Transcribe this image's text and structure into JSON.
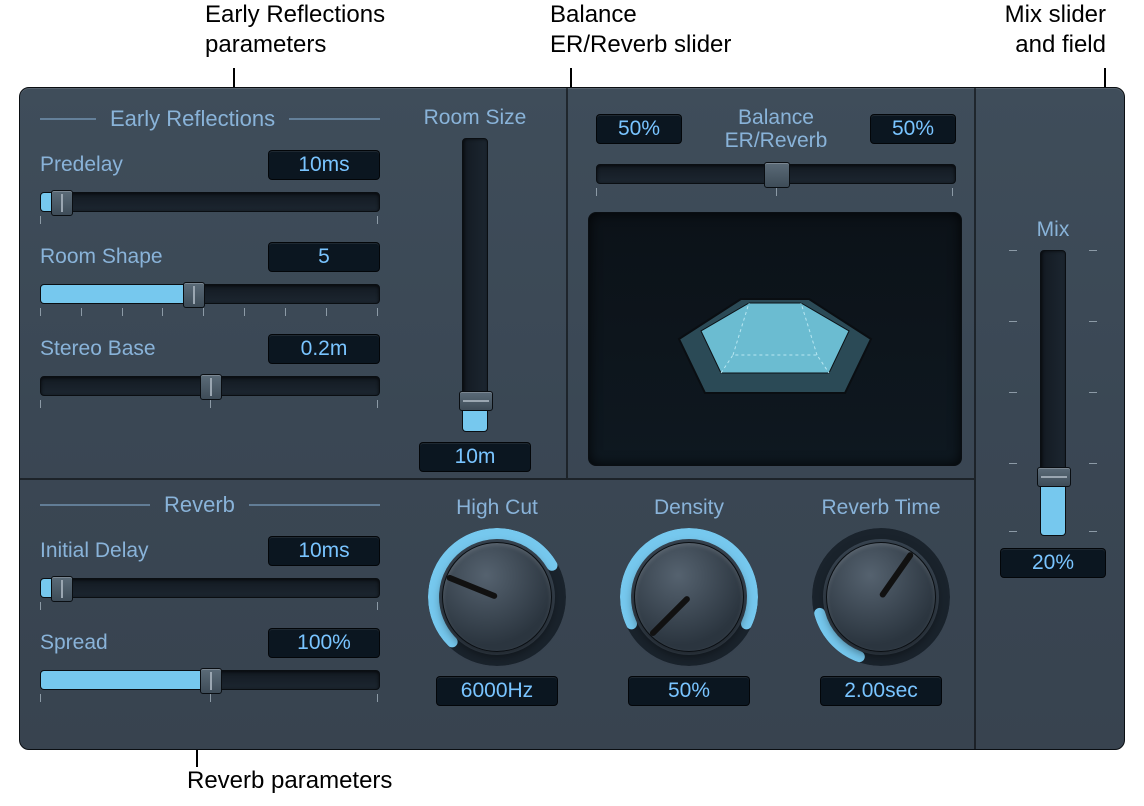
{
  "callouts": {
    "early_reflections": "Early Reflections\nparameters",
    "balance": "Balance\nER/Reverb slider",
    "mix": "Mix slider\nand field",
    "reverb": "Reverb parameters"
  },
  "early_reflections": {
    "section_title": "Early Reflections",
    "predelay": {
      "label": "Predelay",
      "value": "10ms",
      "slider_fill_pct": 6
    },
    "room_shape": {
      "label": "Room Shape",
      "value": "5",
      "slider_fill_pct": 45
    },
    "stereo_base": {
      "label": "Stereo Base",
      "value": "0.2m",
      "slider_fill_pct": 50
    }
  },
  "room_size": {
    "label": "Room Size",
    "value": "10m",
    "fill_pct": 10
  },
  "balance": {
    "label": "Balance\nER/Reverb",
    "left_value": "50%",
    "right_value": "50%",
    "thumb_pct": 50
  },
  "reverb": {
    "section_title": "Reverb",
    "initial_delay": {
      "label": "Initial Delay",
      "value": "10ms",
      "slider_fill_pct": 6
    },
    "spread": {
      "label": "Spread",
      "value": "100%",
      "slider_fill_pct": 50
    }
  },
  "knobs": {
    "high_cut": {
      "label": "High Cut",
      "value": "6000Hz",
      "angle": 112,
      "arc_start": 225,
      "arc_sweep": 195
    },
    "density": {
      "label": "Density",
      "value": "50%",
      "angle": 45,
      "arc_start": 245,
      "arc_sweep": 230
    },
    "reverb_time": {
      "label": "Reverb Time",
      "value": "2.00sec",
      "angle": 215,
      "arc_start": 200,
      "arc_sweep": 55
    }
  },
  "mix": {
    "label": "Mix",
    "value": "20%",
    "fill_pct": 20
  }
}
